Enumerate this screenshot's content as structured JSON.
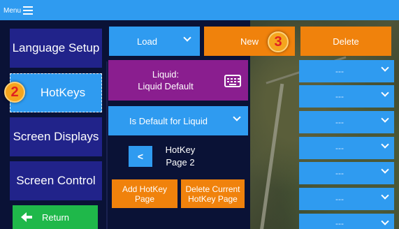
{
  "topbar": {
    "menu_label": "Menu"
  },
  "sidebar": {
    "items": [
      {
        "label": "Language Setup"
      },
      {
        "label": "HotKeys"
      },
      {
        "label": "Screen Displays"
      },
      {
        "label": "Screen Control"
      }
    ],
    "return_label": "Return"
  },
  "toolbar": {
    "load_label": "Load",
    "new_label": "New",
    "delete_label": "Delete"
  },
  "liquid": {
    "line1": "Liquid:",
    "line2": "Liquid Default",
    "default_label": "Is Default for Liquid"
  },
  "hotkey_page": {
    "prev_label": "<",
    "line1": "HotKey",
    "line2": "Page 2",
    "add_label": "Add HotKey Page",
    "delete_label": "Delete Current HotKey Page"
  },
  "badges": {
    "hotkeys_step": "2",
    "new_step": "3"
  },
  "slots": [
    "---",
    "---",
    "---",
    "---",
    "---",
    "---",
    "---"
  ],
  "colors": {
    "accent_blue": "#2f9bf0",
    "orange": "#f0820c",
    "purple": "#8a1e8f",
    "sidebar_blue": "#21238a",
    "green": "#1fb84a",
    "background": "#0a1236"
  }
}
